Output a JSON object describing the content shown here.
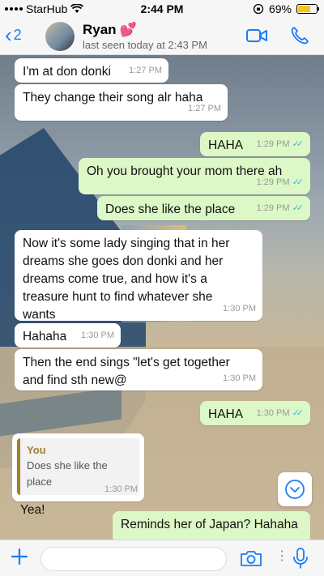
{
  "status_bar": {
    "carrier": "StarHub",
    "time": "2:44 PM",
    "battery_percent": "69%",
    "battery_level": 0.69,
    "icons": [
      "signal-icon",
      "wifi-icon",
      "orientation-lock-icon",
      "battery-icon"
    ]
  },
  "header": {
    "back_count": "2",
    "contact_name": "Ryan",
    "name_emoji": "💕",
    "last_seen": "last seen today at 2:43 PM",
    "icons": [
      "back-chevron-icon",
      "avatar",
      "video-call-icon",
      "phone-call-icon"
    ]
  },
  "messages": [
    {
      "dir": "in",
      "text": "I'm at don donki",
      "time": "1:27 PM"
    },
    {
      "dir": "in",
      "text": "They change their song alr haha",
      "time": "1:27 PM"
    },
    {
      "dir": "out",
      "text": "HAHA",
      "time": "1:29 PM"
    },
    {
      "dir": "out",
      "text": "Oh you brought your mom there ah",
      "time": "1:29 PM"
    },
    {
      "dir": "out",
      "text": "Does she like the place",
      "time": "1:29 PM"
    },
    {
      "dir": "in",
      "text": "Now it's some lady singing that in her dreams she goes don donki and her dreams come true, and how it's a treasure hunt to find whatever she wants",
      "time": "1:30 PM"
    },
    {
      "dir": "in",
      "text": "Hahaha",
      "time": "1:30 PM"
    },
    {
      "dir": "in",
      "text": "Then the end sings \"let's get together and find sth new@",
      "time": "1:30 PM"
    },
    {
      "dir": "out",
      "text": "HAHA",
      "time": "1:30 PM"
    },
    {
      "dir": "in",
      "text": "Yea!",
      "time": "1:30 PM",
      "quote_author": "You",
      "quote_text": "Does she like the place"
    },
    {
      "dir": "out",
      "text": "Reminds her of Japan? Hahaha",
      "time": ""
    }
  ],
  "input": {
    "placeholder": "",
    "icons": [
      "plus-icon",
      "camera-icon",
      "microphone-icon"
    ]
  },
  "colors": {
    "accent": "#1b7cf5",
    "outgoing_bubble": "#dcf8c6",
    "incoming_bubble": "#ffffff",
    "read_ticks": "#34b7f1",
    "quote_accent": "#a0812c"
  }
}
